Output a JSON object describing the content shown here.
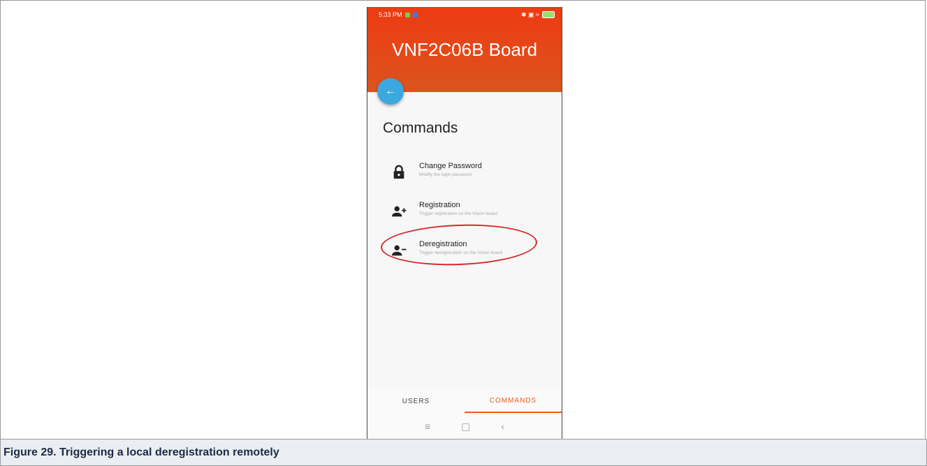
{
  "status_bar": {
    "time": "5:33 PM",
    "right_icons": "✱ ▣ ≈"
  },
  "header": {
    "title": "VNF2C06B Board"
  },
  "back_button": {
    "glyph": "←"
  },
  "section": {
    "title": "Commands"
  },
  "commands": [
    {
      "icon": "lock-icon",
      "title": "Change Password",
      "subtitle": "Modify the login password"
    },
    {
      "icon": "person-add-icon",
      "title": "Registration",
      "subtitle": "Trigger registration on the Vision board"
    },
    {
      "icon": "person-remove-icon",
      "title": "Deregistration",
      "subtitle": "Trigger deregistration on the Vision board"
    }
  ],
  "tabs": [
    {
      "label": "USERS",
      "active": false
    },
    {
      "label": "COMMANDS",
      "active": true
    }
  ],
  "nav": {
    "menu": "≡",
    "home": "▢",
    "back": "‹"
  },
  "caption": "Figure 29.  Triggering a local deregistration remotely",
  "colors": {
    "header": "#e8451a",
    "accent": "#ef5a1f",
    "fab": "#3ba9df",
    "highlight": "#d8282e",
    "caption_bg": "#eaeef3"
  }
}
